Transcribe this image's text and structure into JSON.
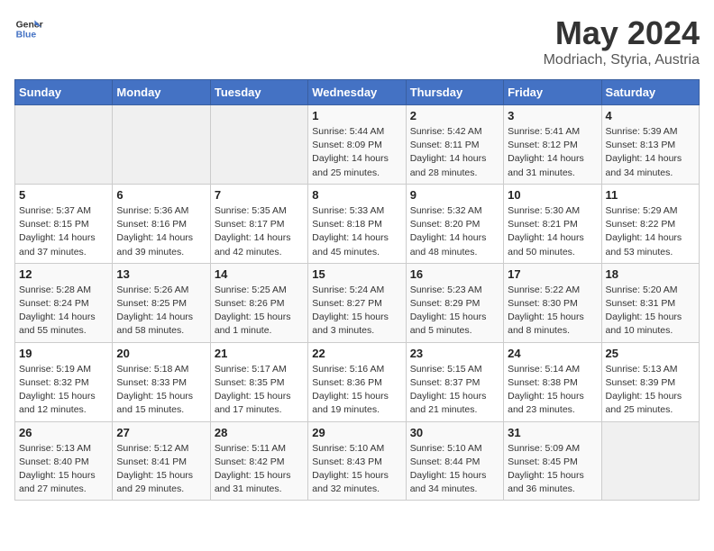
{
  "header": {
    "logo_line1": "General",
    "logo_line2": "Blue",
    "title": "May 2024",
    "subtitle": "Modriach, Styria, Austria"
  },
  "days_of_week": [
    "Sunday",
    "Monday",
    "Tuesday",
    "Wednesday",
    "Thursday",
    "Friday",
    "Saturday"
  ],
  "weeks": [
    [
      {
        "day": "",
        "info": ""
      },
      {
        "day": "",
        "info": ""
      },
      {
        "day": "",
        "info": ""
      },
      {
        "day": "1",
        "info": "Sunrise: 5:44 AM\nSunset: 8:09 PM\nDaylight: 14 hours and 25 minutes."
      },
      {
        "day": "2",
        "info": "Sunrise: 5:42 AM\nSunset: 8:11 PM\nDaylight: 14 hours and 28 minutes."
      },
      {
        "day": "3",
        "info": "Sunrise: 5:41 AM\nSunset: 8:12 PM\nDaylight: 14 hours and 31 minutes."
      },
      {
        "day": "4",
        "info": "Sunrise: 5:39 AM\nSunset: 8:13 PM\nDaylight: 14 hours and 34 minutes."
      }
    ],
    [
      {
        "day": "5",
        "info": "Sunrise: 5:37 AM\nSunset: 8:15 PM\nDaylight: 14 hours and 37 minutes."
      },
      {
        "day": "6",
        "info": "Sunrise: 5:36 AM\nSunset: 8:16 PM\nDaylight: 14 hours and 39 minutes."
      },
      {
        "day": "7",
        "info": "Sunrise: 5:35 AM\nSunset: 8:17 PM\nDaylight: 14 hours and 42 minutes."
      },
      {
        "day": "8",
        "info": "Sunrise: 5:33 AM\nSunset: 8:18 PM\nDaylight: 14 hours and 45 minutes."
      },
      {
        "day": "9",
        "info": "Sunrise: 5:32 AM\nSunset: 8:20 PM\nDaylight: 14 hours and 48 minutes."
      },
      {
        "day": "10",
        "info": "Sunrise: 5:30 AM\nSunset: 8:21 PM\nDaylight: 14 hours and 50 minutes."
      },
      {
        "day": "11",
        "info": "Sunrise: 5:29 AM\nSunset: 8:22 PM\nDaylight: 14 hours and 53 minutes."
      }
    ],
    [
      {
        "day": "12",
        "info": "Sunrise: 5:28 AM\nSunset: 8:24 PM\nDaylight: 14 hours and 55 minutes."
      },
      {
        "day": "13",
        "info": "Sunrise: 5:26 AM\nSunset: 8:25 PM\nDaylight: 14 hours and 58 minutes."
      },
      {
        "day": "14",
        "info": "Sunrise: 5:25 AM\nSunset: 8:26 PM\nDaylight: 15 hours and 1 minute."
      },
      {
        "day": "15",
        "info": "Sunrise: 5:24 AM\nSunset: 8:27 PM\nDaylight: 15 hours and 3 minutes."
      },
      {
        "day": "16",
        "info": "Sunrise: 5:23 AM\nSunset: 8:29 PM\nDaylight: 15 hours and 5 minutes."
      },
      {
        "day": "17",
        "info": "Sunrise: 5:22 AM\nSunset: 8:30 PM\nDaylight: 15 hours and 8 minutes."
      },
      {
        "day": "18",
        "info": "Sunrise: 5:20 AM\nSunset: 8:31 PM\nDaylight: 15 hours and 10 minutes."
      }
    ],
    [
      {
        "day": "19",
        "info": "Sunrise: 5:19 AM\nSunset: 8:32 PM\nDaylight: 15 hours and 12 minutes."
      },
      {
        "day": "20",
        "info": "Sunrise: 5:18 AM\nSunset: 8:33 PM\nDaylight: 15 hours and 15 minutes."
      },
      {
        "day": "21",
        "info": "Sunrise: 5:17 AM\nSunset: 8:35 PM\nDaylight: 15 hours and 17 minutes."
      },
      {
        "day": "22",
        "info": "Sunrise: 5:16 AM\nSunset: 8:36 PM\nDaylight: 15 hours and 19 minutes."
      },
      {
        "day": "23",
        "info": "Sunrise: 5:15 AM\nSunset: 8:37 PM\nDaylight: 15 hours and 21 minutes."
      },
      {
        "day": "24",
        "info": "Sunrise: 5:14 AM\nSunset: 8:38 PM\nDaylight: 15 hours and 23 minutes."
      },
      {
        "day": "25",
        "info": "Sunrise: 5:13 AM\nSunset: 8:39 PM\nDaylight: 15 hours and 25 minutes."
      }
    ],
    [
      {
        "day": "26",
        "info": "Sunrise: 5:13 AM\nSunset: 8:40 PM\nDaylight: 15 hours and 27 minutes."
      },
      {
        "day": "27",
        "info": "Sunrise: 5:12 AM\nSunset: 8:41 PM\nDaylight: 15 hours and 29 minutes."
      },
      {
        "day": "28",
        "info": "Sunrise: 5:11 AM\nSunset: 8:42 PM\nDaylight: 15 hours and 31 minutes."
      },
      {
        "day": "29",
        "info": "Sunrise: 5:10 AM\nSunset: 8:43 PM\nDaylight: 15 hours and 32 minutes."
      },
      {
        "day": "30",
        "info": "Sunrise: 5:10 AM\nSunset: 8:44 PM\nDaylight: 15 hours and 34 minutes."
      },
      {
        "day": "31",
        "info": "Sunrise: 5:09 AM\nSunset: 8:45 PM\nDaylight: 15 hours and 36 minutes."
      },
      {
        "day": "",
        "info": ""
      }
    ]
  ]
}
